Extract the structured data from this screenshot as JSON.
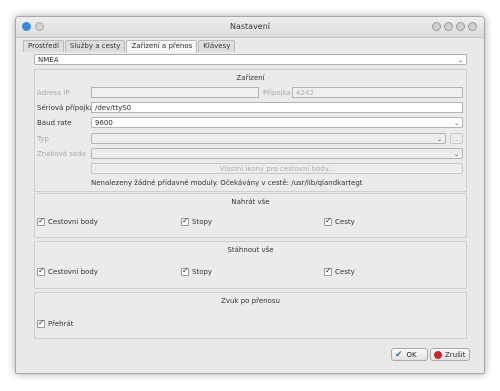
{
  "window": {
    "title": "Nastavení"
  },
  "tabs": [
    "Prostředí",
    "Služby a cesty",
    "Zařízení a přenos",
    "Klávesy"
  ],
  "protocol": {
    "value": "NMEA"
  },
  "device": {
    "title": "Zařízení",
    "ip_label": "Adresa IP",
    "port_label": "Přípojka",
    "port_value": "4242",
    "serial_label": "Sériová přípojka",
    "serial_value": "/dev/ttyS0",
    "baud_label": "Baud rate",
    "baud_value": "9600",
    "type_label": "Typ",
    "charset_label": "Znaková sada",
    "custom_icons_button": "Vlastní ikony pro cestovní body...",
    "no_modules": "Nenalezeny žádné přídavné moduly. Očekávány v cestě: /usr/lib/qlandkartegt"
  },
  "upload": {
    "title": "Nahrát vše",
    "waypoints": "Cestovní body",
    "tracks": "Stopy",
    "routes": "Cesty"
  },
  "download": {
    "title": "Stáhnout vše",
    "waypoints": "Cestovní body",
    "tracks": "Stopy",
    "routes": "Cesty"
  },
  "sound": {
    "title": "Zvuk po přenosu",
    "play": "Přehrát"
  },
  "buttons": {
    "ok": "OK",
    "cancel": "Zrušit"
  },
  "colors": {
    "ok_check": "#2f6fb5",
    "cancel_icon": "#c8262a"
  }
}
